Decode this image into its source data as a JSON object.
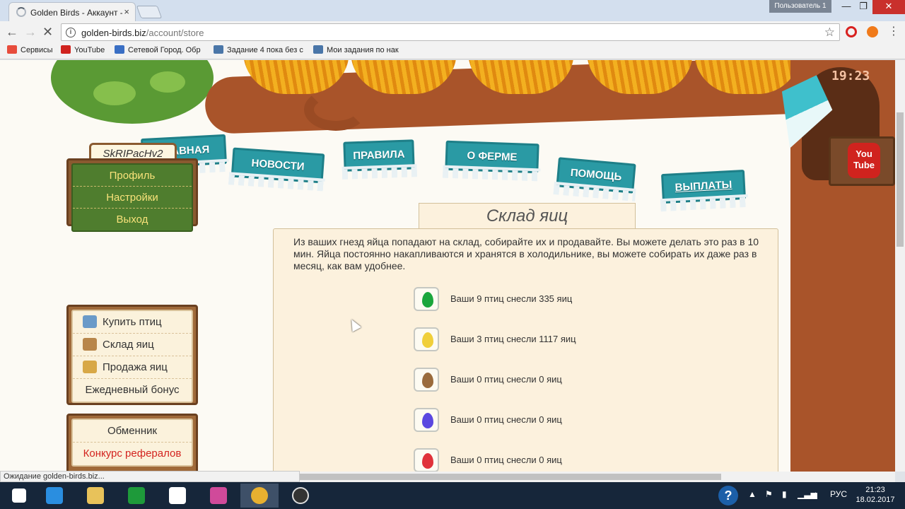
{
  "browser": {
    "tab_title": "Golden Birds - Аккаунт -",
    "tab_close": "×",
    "user_label": "Пользователь 1",
    "win_min": "—",
    "win_max": "❐",
    "win_close": "✕",
    "url_host": "golden-birds.biz",
    "url_path": "/account/store",
    "back": "←",
    "forward": "→",
    "reload": "✕",
    "star": "☆",
    "info": "i",
    "menu": "⋮",
    "status": "Ожидание golden-birds.biz..."
  },
  "bookmarks": [
    {
      "label": "Сервисы",
      "color": "#e74c3c"
    },
    {
      "label": "YouTube",
      "color": "#d0231e"
    },
    {
      "label": "Сетевой Город. Обр",
      "color": "#3a6fc4"
    },
    {
      "label": "Задание 4 пока без с",
      "color": "#4a76a8"
    },
    {
      "label": "Мои задания по нак",
      "color": "#4a76a8"
    }
  ],
  "header": {
    "clock": "19:23",
    "youtube_line1": "You",
    "youtube_line2": "Tube"
  },
  "nav": [
    {
      "label": "ГЛАВНАЯ"
    },
    {
      "label": "НОВОСТИ"
    },
    {
      "label": "ПРАВИЛА"
    },
    {
      "label": "О ФЕРМЕ"
    },
    {
      "label": "ПОМОЩЬ"
    },
    {
      "label": "ВЫПЛАТЫ"
    }
  ],
  "sidebar": {
    "username": "SkRIPacHv2",
    "account_menu": [
      "Профиль",
      "Настройки",
      "Выход"
    ],
    "shop_menu": [
      "Купить птиц",
      "Склад яиц",
      "Продажа яиц",
      "Ежедневный бонус"
    ],
    "extra_menu": [
      "Обменник",
      "Конкурс рефералов"
    ]
  },
  "content": {
    "title": "Склад яиц",
    "intro": "Из ваших гнезд яйца попадают на склад, собирайте их и продавайте. Вы можете делать это раз в 10 мин. Яйца постоянно накапливаются и хранятся в холодильнике, вы можете собирать их даже раз в месяц, как вам удобнее.",
    "eggs": [
      {
        "color": "#1aa63c",
        "text": "Ваши 9 птиц снесли 335 яиц"
      },
      {
        "color": "#f0cf3a",
        "text": "Ваши 3 птиц снесли 1117 яиц"
      },
      {
        "color": "#9a6b3c",
        "text": "Ваши 0 птиц снесли 0 яиц"
      },
      {
        "color": "#5a48e0",
        "text": "Ваши 0 птиц снесли 0 яиц"
      },
      {
        "color": "#e0323a",
        "text": "Ваши 0 птиц снесли 0 яиц"
      }
    ]
  },
  "taskbar": {
    "lang": "РУС",
    "time": "21:23",
    "date": "18.02.2017",
    "help": "?"
  }
}
